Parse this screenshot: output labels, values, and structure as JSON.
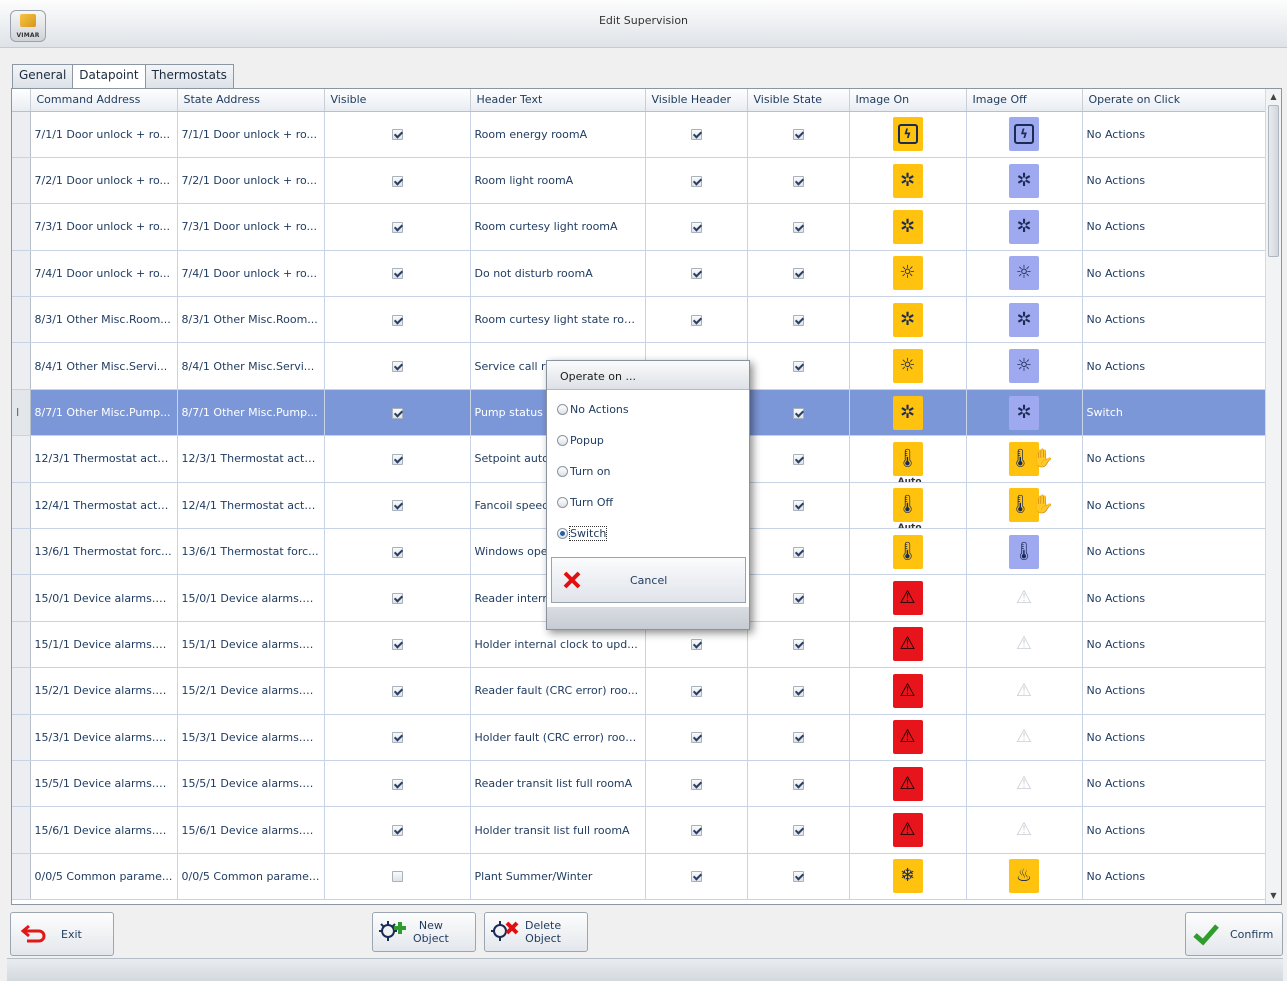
{
  "window": {
    "title": "Edit Supervision",
    "logo_text": "VIMAR"
  },
  "tabs": [
    {
      "label": "General",
      "active": false
    },
    {
      "label": "Datapoint",
      "active": true
    },
    {
      "label": "Thermostats",
      "active": false
    }
  ],
  "columns": [
    "Command Address",
    "State Address",
    "Visible",
    "Header Text",
    "Visible Header",
    "Visible State",
    "Image On",
    "Image Off",
    "Operate on Click"
  ],
  "rows": [
    {
      "cmd": "7/1/1 Door unlock + ro...",
      "state": "7/1/1 Door unlock + ro...",
      "visible": true,
      "header": "Room energy roomA",
      "vh": true,
      "vs": true,
      "on": "energy-yellow",
      "off": "energy-blue",
      "op": "No Actions"
    },
    {
      "cmd": "7/2/1 Door unlock + ro...",
      "state": "7/2/1 Door unlock + ro...",
      "visible": true,
      "header": "Room light roomA",
      "vh": true,
      "vs": true,
      "on": "light-yellow",
      "off": "light-blue",
      "op": "No Actions"
    },
    {
      "cmd": "7/3/1 Door unlock + ro...",
      "state": "7/3/1 Door unlock + ro...",
      "visible": true,
      "header": "Room curtesy light roomA",
      "vh": true,
      "vs": true,
      "on": "light-yellow",
      "off": "light-blue",
      "op": "No Actions"
    },
    {
      "cmd": "7/4/1 Door unlock + ro...",
      "state": "7/4/1 Door unlock + ro...",
      "visible": true,
      "header": "Do not disturb roomA",
      "vh": true,
      "vs": true,
      "on": "bulb-yellow",
      "off": "bulb-blue",
      "op": "No Actions"
    },
    {
      "cmd": "8/3/1 Other Misc.Room...",
      "state": "8/3/1 Other Misc.Room...",
      "visible": true,
      "header": "Room curtesy light state roo...",
      "vh": true,
      "vs": true,
      "on": "light-yellow",
      "off": "light-blue",
      "op": "No Actions"
    },
    {
      "cmd": "8/4/1 Other Misc.Servi...",
      "state": "8/4/1 Other Misc.Servi...",
      "visible": true,
      "header": "Service call ro",
      "vh": true,
      "vs": true,
      "on": "bulb-yellow",
      "off": "bulb-blue",
      "op": "No Actions"
    },
    {
      "cmd": "8/7/1 Other Misc.Pump...",
      "state": "8/7/1 Other Misc.Pump...",
      "visible": true,
      "header": "Pump status",
      "vh": true,
      "vs": true,
      "on": "light-yellow",
      "off": "light-blue",
      "op": "Switch",
      "selected": true
    },
    {
      "cmd": "12/3/1 Thermostat actu...",
      "state": "12/3/1 Thermostat actu...",
      "visible": true,
      "header": "Setpoint auto",
      "vh": true,
      "vs": true,
      "on": "thermo-auto",
      "off": "thermo-hand",
      "op": "No Actions"
    },
    {
      "cmd": "12/4/1 Thermostat actu...",
      "state": "12/4/1 Thermostat actu...",
      "visible": true,
      "header": "Fancoil speed",
      "vh": true,
      "vs": true,
      "on": "thermo-auto",
      "off": "thermo-hand",
      "op": "No Actions"
    },
    {
      "cmd": "13/6/1 Thermostat forc...",
      "state": "13/6/1 Thermostat forc...",
      "visible": true,
      "header": "Windows ope",
      "vh": true,
      "vs": true,
      "on": "thermo-window-yellow",
      "off": "thermo-window-blue",
      "op": "No Actions"
    },
    {
      "cmd": "15/0/1 Device alarms.R...",
      "state": "15/0/1 Device alarms.R...",
      "visible": true,
      "header": "Reader intern",
      "vh": true,
      "vs": true,
      "on": "alarm-red",
      "off": "alarm-white",
      "op": "No Actions"
    },
    {
      "cmd": "15/1/1 Device alarms.H...",
      "state": "15/1/1 Device alarms.H...",
      "visible": true,
      "header": "Holder internal clock to upd...",
      "vh": true,
      "vs": true,
      "on": "alarm-red",
      "off": "alarm-white",
      "op": "No Actions"
    },
    {
      "cmd": "15/2/1 Device alarms.R...",
      "state": "15/2/1 Device alarms.R...",
      "visible": true,
      "header": "Reader fault (CRC error) roo...",
      "vh": true,
      "vs": true,
      "on": "alarm-red",
      "off": "alarm-white",
      "op": "No Actions"
    },
    {
      "cmd": "15/3/1 Device alarms.H...",
      "state": "15/3/1 Device alarms.H...",
      "visible": true,
      "header": "Holder fault (CRC error) roomA",
      "vh": true,
      "vs": true,
      "on": "alarm-red",
      "off": "alarm-white",
      "op": "No Actions"
    },
    {
      "cmd": "15/5/1 Device alarms.R...",
      "state": "15/5/1 Device alarms.R...",
      "visible": true,
      "header": "Reader transit list full roomA",
      "vh": true,
      "vs": true,
      "on": "alarm-red",
      "off": "alarm-white",
      "op": "No Actions"
    },
    {
      "cmd": "15/6/1 Device alarms.H...",
      "state": "15/6/1 Device alarms.H...",
      "visible": true,
      "header": "Holder transit list full roomA",
      "vh": true,
      "vs": true,
      "on": "alarm-red",
      "off": "alarm-white",
      "op": "No Actions"
    },
    {
      "cmd": "0/0/5 Common parame...",
      "state": "0/0/5 Common parame...",
      "visible": false,
      "header": "Plant Summer/Winter",
      "vh": true,
      "vs": true,
      "on": "snow-yellow",
      "off": "heat-yellow",
      "op": "No Actions"
    }
  ],
  "image_auto_label": "Auto",
  "buttons": {
    "exit": "Exit",
    "new_object": [
      "New",
      "Object"
    ],
    "delete_object": [
      "Delete",
      "Object"
    ],
    "confirm": "Confirm"
  },
  "dialog": {
    "title": "Operate on ...",
    "options": [
      {
        "label": "No Actions",
        "selected": false
      },
      {
        "label": "Popup",
        "selected": false
      },
      {
        "label": "Turn on",
        "selected": false
      },
      {
        "label": "Turn Off",
        "selected": false
      },
      {
        "label": "Switch",
        "selected": true
      }
    ],
    "cancel_label": "Cancel"
  },
  "colors": {
    "selection": "#7c97d8",
    "image_yellow": "#ffc20e",
    "image_blue": "#9ea9f0",
    "alarm_red": "#e8141b",
    "confirm_green": "#2e9d2b",
    "cancel_red": "#e01010"
  }
}
